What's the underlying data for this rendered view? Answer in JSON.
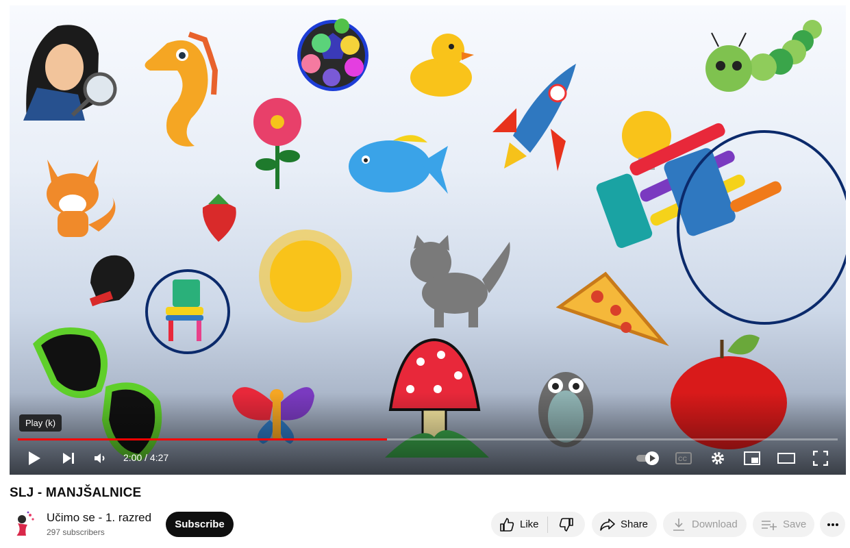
{
  "player": {
    "tooltip": "Play (k)",
    "time_display": "2:00 / 4:27",
    "progress_played": 0.45,
    "progress_buffered": 0.92
  },
  "video": {
    "title": "SLJ - MANJŠALNICE"
  },
  "channel": {
    "name": "Učimo se - 1. razred",
    "subscribers": "297 subscribers",
    "subscribe_label": "Subscribe"
  },
  "actions": {
    "like_label": "Like",
    "share_label": "Share",
    "download_label": "Download",
    "save_label": "Save"
  },
  "colors": {
    "progress_played": "#ff0000",
    "subscribe_bg": "#0f0f0f",
    "pill_bg": "#f2f2f2",
    "circle_outline": "#0b2a6b"
  },
  "icons": {
    "controls": [
      "play-icon",
      "next-icon",
      "volume-icon",
      "autoplay-toggle-icon",
      "captions-icon",
      "settings-icon",
      "miniplayer-icon",
      "theater-icon",
      "fullscreen-icon"
    ],
    "actions": [
      "like-icon",
      "dislike-icon",
      "share-icon",
      "download-icon",
      "save-icon",
      "more-icon"
    ]
  }
}
